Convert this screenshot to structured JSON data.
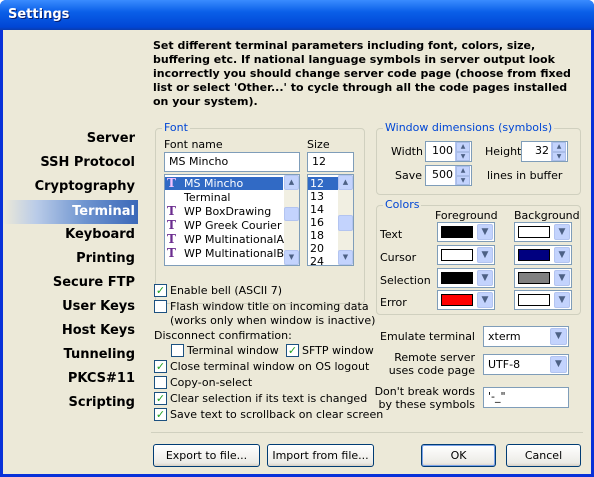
{
  "window": {
    "title": "Settings"
  },
  "description": "Set different terminal parameters including font, colors, size, buffering etc. If national language symbols in server output look incorrectly you should change server code page (choose from fixed list or select 'Other...' to cycle through all the code pages installed on your system).",
  "nav": [
    "Server",
    "SSH Protocol",
    "Cryptography",
    "Terminal",
    "Keyboard",
    "Printing",
    "Secure FTP",
    "User Keys",
    "Host Keys",
    "Tunneling",
    "PKCS#11",
    "Scripting"
  ],
  "nav_selected": "Terminal",
  "font": {
    "legend": "Font",
    "name_label": "Font name",
    "size_label": "Size",
    "name_value": "MS Mincho",
    "size_value": "12",
    "fonts": [
      "MS Mincho",
      "Terminal",
      "WP BoxDrawing",
      "WP Greek Courier",
      "WP MultinationalA C",
      "WP MultinationalB C"
    ],
    "sizes": [
      "12",
      "13",
      "14",
      "16",
      "18",
      "20",
      "24"
    ]
  },
  "window_dims": {
    "legend": "Window dimensions (symbols)",
    "width_label": "Width",
    "width_value": "100",
    "height_label": "Height",
    "height_value": "32",
    "save_label": "Save",
    "save_value": "500",
    "buffer_label": "lines in buffer"
  },
  "colors": {
    "legend": "Colors",
    "fg_label": "Foreground",
    "bg_label": "Background",
    "rows": [
      {
        "label": "Text",
        "fg": "#000000",
        "bg": "#ffffff"
      },
      {
        "label": "Cursor",
        "fg": "#ffffff",
        "bg": "#000080"
      },
      {
        "label": "Selection",
        "fg": "#000000",
        "bg": "#808080"
      },
      {
        "label": "Error",
        "fg": "#ff0000",
        "bg": "#ffffff"
      }
    ]
  },
  "options": {
    "enable_bell": "Enable bell (ASCII 7)",
    "flash_title": "Flash window title on incoming data",
    "flash_note": "(works only when window is inactive)",
    "disconnect_label": "Disconnect confirmation:",
    "terminal_window": "Terminal window",
    "sftp_window": "SFTP window",
    "close_on_logout": "Close terminal window on OS logout",
    "copy_on_select": "Copy-on-select",
    "clear_selection": "Clear selection if its text is changed",
    "save_scrollback": "Save text to scrollback on clear screen"
  },
  "checks": {
    "enable_bell": true,
    "flash_title": false,
    "terminal_window": false,
    "sftp_window": true,
    "close_on_logout": true,
    "copy_on_select": false,
    "clear_selection": true,
    "save_scrollback": true
  },
  "emulation": {
    "emulate_label": "Emulate terminal",
    "emulate_value": "xterm",
    "codepage_label1": "Remote server",
    "codepage_label2": "uses code page",
    "codepage_value": "UTF-8",
    "nobreak_label1": "Don't break words",
    "nobreak_label2": "by these symbols",
    "nobreak_value": "'-_\""
  },
  "buttons": {
    "export": "Export to file...",
    "import": "Import from file...",
    "ok": "OK",
    "cancel": "Cancel"
  },
  "check_glyph": "✓"
}
